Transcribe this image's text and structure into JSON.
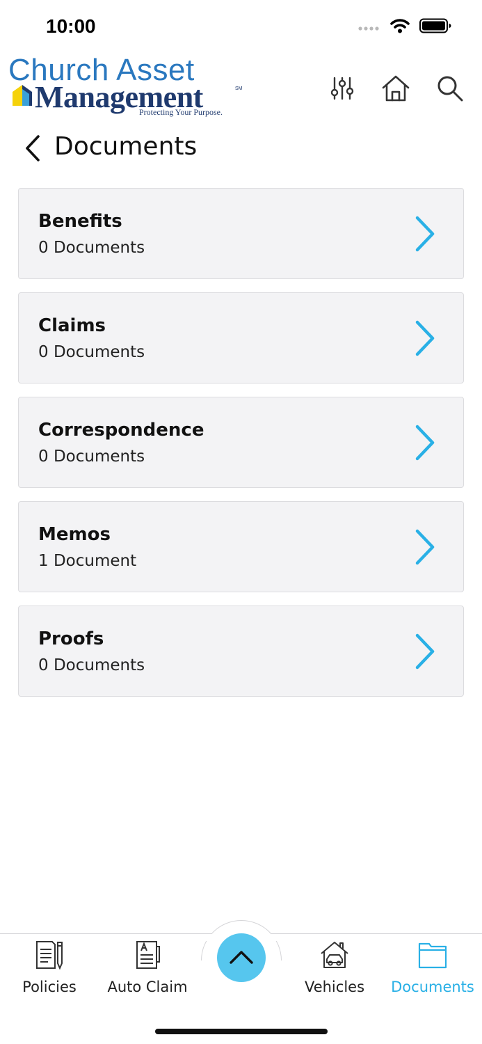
{
  "status_bar": {
    "time": "10:00",
    "icons": [
      "signal-dots-icon",
      "wifi-icon",
      "battery-icon"
    ]
  },
  "header": {
    "logo": {
      "line1": "Church Asset",
      "line2": "Management",
      "service_mark": "SM",
      "tagline": "Protecting Your Purpose."
    },
    "actions": [
      "filter-sliders-icon",
      "home-icon",
      "search-icon"
    ]
  },
  "page": {
    "title": "Documents",
    "back_icon": "chevron-left-icon"
  },
  "categories": [
    {
      "title": "Benefits",
      "count": "0 Documents"
    },
    {
      "title": "Claims",
      "count": "0 Documents"
    },
    {
      "title": "Correspondence",
      "count": "0 Documents"
    },
    {
      "title": "Memos",
      "count": "1 Document"
    },
    {
      "title": "Proofs",
      "count": "0 Documents"
    }
  ],
  "bottom_nav": {
    "items": [
      {
        "label": "Policies",
        "icon": "policy-document-icon"
      },
      {
        "label": "Auto Claim",
        "icon": "claim-form-icon"
      },
      {
        "label": "Vehicles",
        "icon": "house-car-icon"
      },
      {
        "label": "Documents",
        "icon": "folder-icon",
        "active": true
      }
    ],
    "center_button_icon": "chevron-up-icon"
  },
  "colors": {
    "accent": "#29b0e6",
    "fab": "#56c6ee",
    "card_bg": "#f3f3f5",
    "logo_blue": "#2a78bf",
    "logo_navy": "#1f3a6e"
  }
}
